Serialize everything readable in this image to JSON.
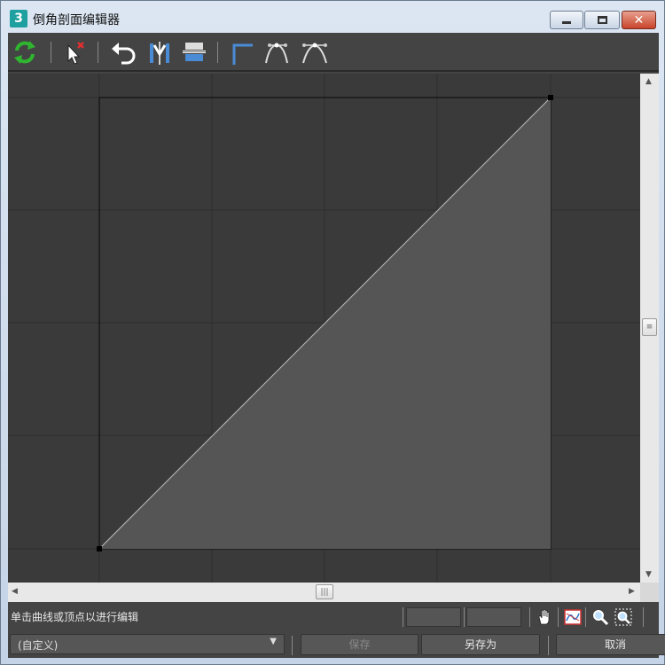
{
  "window": {
    "title": "倒角剖面编辑器",
    "app_icon_label": "3",
    "controls": {
      "minimize": "minimize",
      "maximize": "maximize",
      "close": "✕"
    }
  },
  "toolbar": {
    "tools": [
      {
        "name": "reset-curve-icon"
      },
      {
        "name": "delete-point-icon"
      },
      {
        "name": "undo-icon"
      },
      {
        "name": "flip-horizontal-icon"
      },
      {
        "name": "flip-vertical-icon"
      },
      {
        "name": "corner-point-icon"
      },
      {
        "name": "bezier-smooth-icon"
      },
      {
        "name": "bezier-corner-icon"
      }
    ]
  },
  "colors": {
    "canvas_bg": "#3a3a3a",
    "grid_line": "#2f2f2f",
    "fill_area": "#555555",
    "curve": "#cfcfcf",
    "reset_icon": "#2fb52f",
    "tool_blue": "#4a8bd6"
  },
  "status": {
    "hint": "单击曲线或顶点以进行编辑",
    "coord_x": "",
    "coord_y": "",
    "nav_icons": [
      "pan-hand-icon",
      "zoom-extents-icon",
      "zoom-icon",
      "zoom-region-icon"
    ]
  },
  "footer": {
    "preset": "(自定义)",
    "save": "保存",
    "save_as": "另存为",
    "cancel": "取消"
  }
}
